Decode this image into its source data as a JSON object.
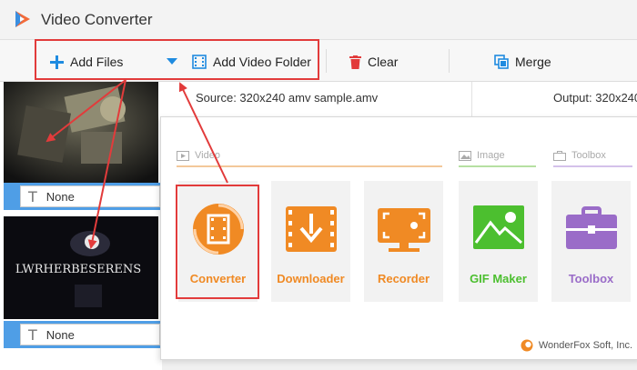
{
  "app": {
    "title": "Video Converter"
  },
  "toolbar": {
    "add_files": "Add Files",
    "add_video_folder": "Add Video Folder",
    "clear": "Clear",
    "merge": "Merge"
  },
  "files": [
    {
      "subtitle": "None",
      "thumb_text": ""
    },
    {
      "subtitle": "None",
      "thumb_text": "LWRHERBESERENS"
    }
  ],
  "info": {
    "source": "Source: 320x240 amv sample.amv",
    "output": "Output: 320x240"
  },
  "popup": {
    "categories": [
      "Video",
      "Image",
      "Toolbox"
    ],
    "tiles": [
      {
        "label": "Converter",
        "color": "#f08a24"
      },
      {
        "label": "Downloader",
        "color": "#f08a24"
      },
      {
        "label": "Recorder",
        "color": "#f08a24"
      },
      {
        "label": "GIF Maker",
        "color": "#4cbf2f"
      },
      {
        "label": "Toolbox",
        "color": "#9a6cc8"
      }
    ],
    "brand": "WonderFox Soft, Inc."
  },
  "colors": {
    "accent_blue": "#1f8be0",
    "highlight_red": "#e23b3b",
    "orange": "#f08a24",
    "green": "#4cbf2f",
    "purple": "#9a6cc8"
  }
}
